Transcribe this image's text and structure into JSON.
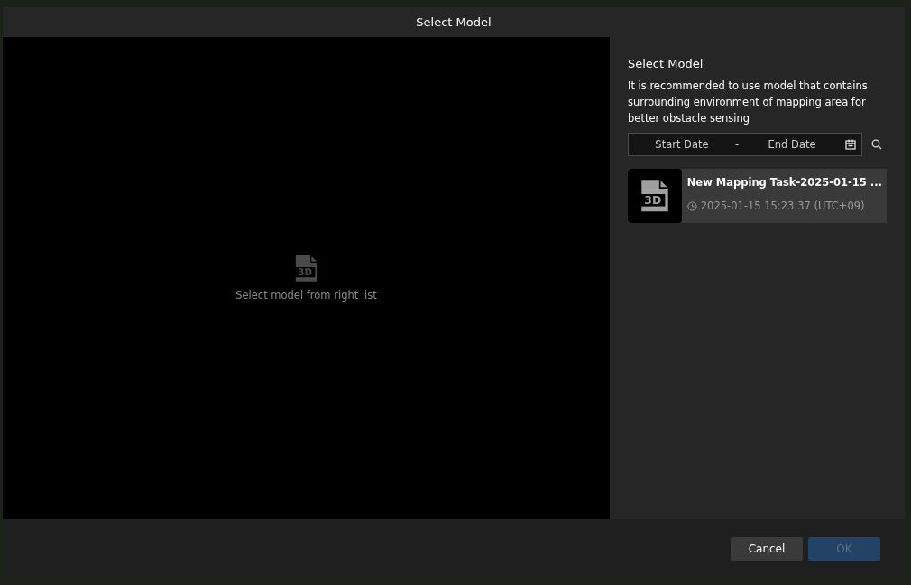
{
  "dialog": {
    "title": "Select Model"
  },
  "preview": {
    "icon_label": "3D",
    "hint": "Select model from right list"
  },
  "panel": {
    "heading": "Select Model",
    "description": "It is recommended to use model that contains surrounding environment of mapping area for better obstacle sensing",
    "date_range": {
      "start_placeholder": "Start Date",
      "separator": "-",
      "end_placeholder": "End Date"
    },
    "models": [
      {
        "icon_label": "3D",
        "name": "New Mapping Task-2025-01-15 ...",
        "time": "2025-01-15 15:23:37 (UTC+09)"
      }
    ]
  },
  "buttons": [
    {
      "label": "Cancel",
      "kind": "secondary",
      "disabled": false
    },
    {
      "label": "OK",
      "kind": "primary",
      "disabled": true
    }
  ]
}
